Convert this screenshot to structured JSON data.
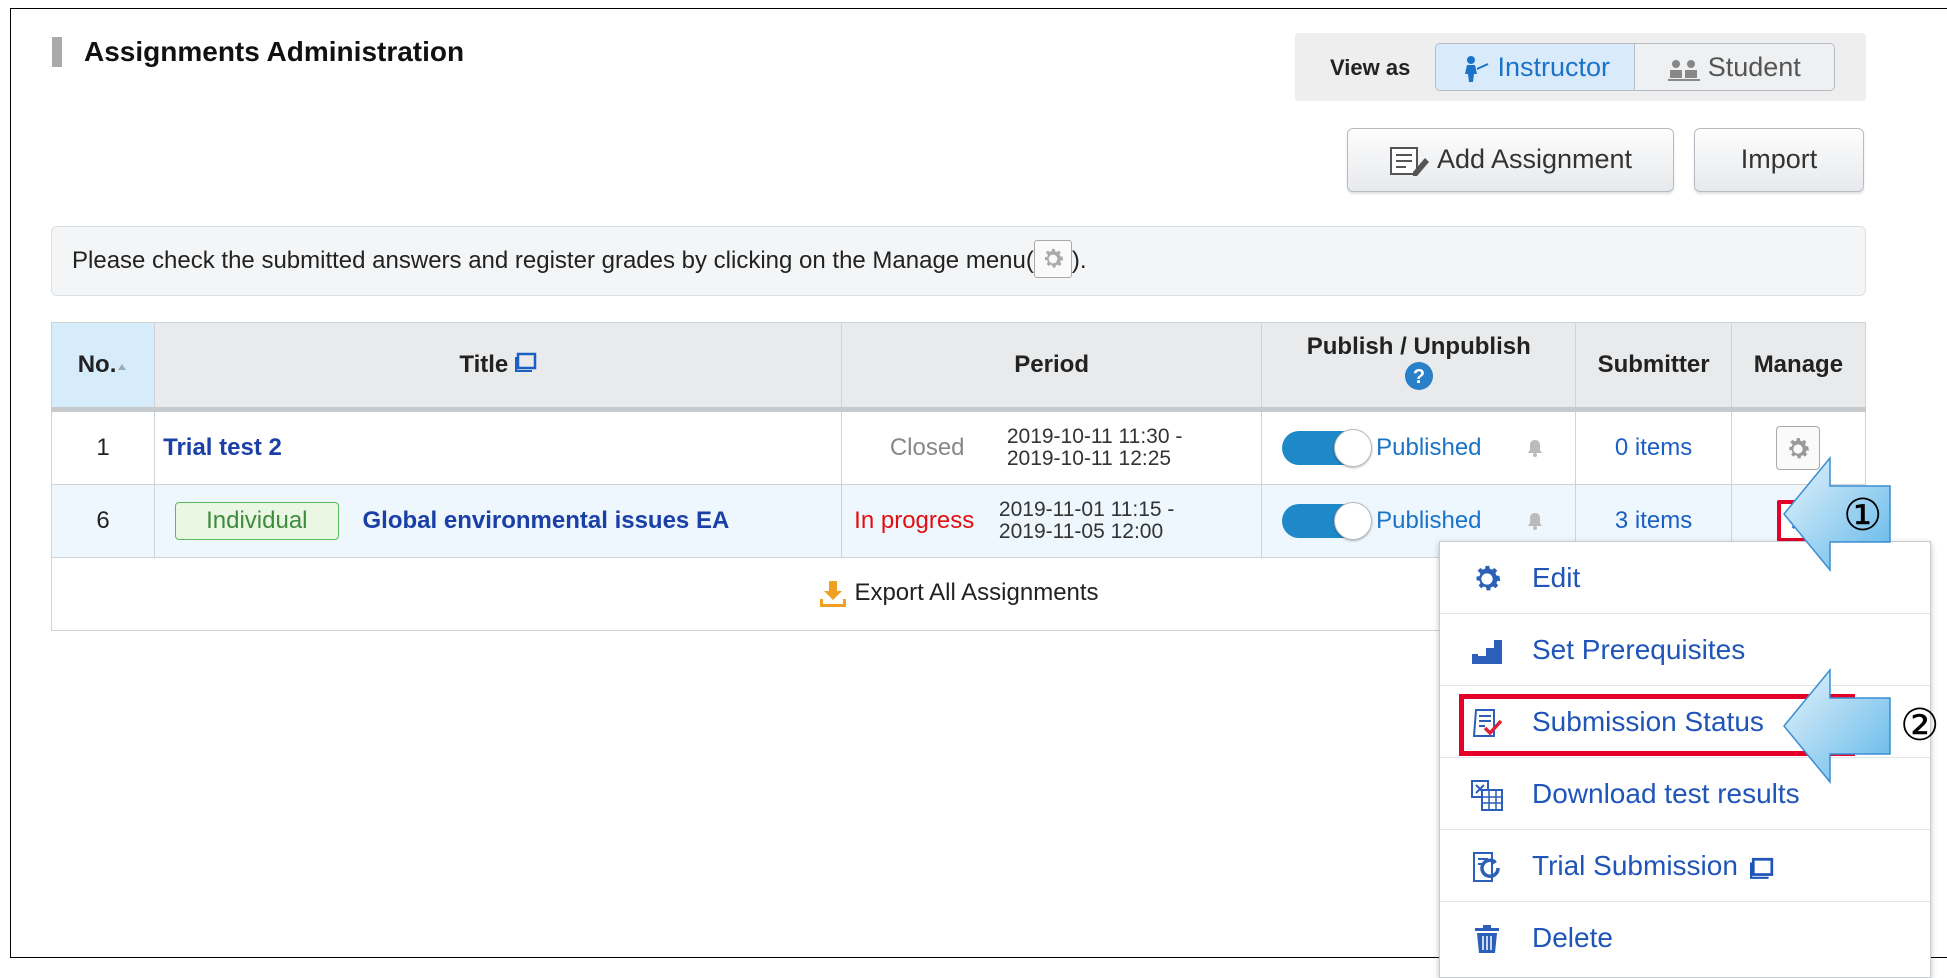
{
  "header": {
    "title": "Assignments Administration",
    "view_as_label": "View as",
    "view_instructor": "Instructor",
    "view_student": "Student"
  },
  "toolbar": {
    "add_label": "Add Assignment",
    "import_label": "Import"
  },
  "notice": {
    "text_before": "Please check the submitted answers and register grades by clicking on the Manage menu(",
    "text_after": ")."
  },
  "table": {
    "headers": {
      "no": "No.",
      "title": "Title",
      "period": "Period",
      "publish": "Publish / Unpublish",
      "submitter": "Submitter",
      "manage": "Manage"
    },
    "rows": [
      {
        "no": "1",
        "badge": "",
        "title": "Trial test 2",
        "status": "Closed",
        "period_start": "2019-10-11 11:30 -",
        "period_end": "2019-10-11 12:25",
        "publish": "Published",
        "submitter": "0 items"
      },
      {
        "no": "6",
        "badge": "Individual",
        "title": "Global environmental issues EA",
        "status": "In progress",
        "period_start": "2019-11-01 11:15 -",
        "period_end": "2019-11-05 12:00",
        "publish": "Published",
        "submitter": "3 items"
      }
    ],
    "export_label": "Export All Assignments"
  },
  "menu": {
    "items": [
      {
        "label": "Edit",
        "icon": "gear-icon"
      },
      {
        "label": "Set Prerequisites",
        "icon": "stairs-icon"
      },
      {
        "label": "Submission Status",
        "icon": "checklist-icon"
      },
      {
        "label": "Download test results",
        "icon": "spreadsheet-icon"
      },
      {
        "label": "Trial Submission",
        "icon": "trial-icon"
      },
      {
        "label": "Delete",
        "icon": "trash-icon"
      }
    ]
  },
  "annotations": {
    "step1": "①",
    "step2": "②"
  },
  "colors": {
    "accent": "#1a73c8",
    "link": "#1a3fa6",
    "highlight": "#e5002a",
    "toggle": "#1e88c9",
    "in_progress": "#e01010"
  }
}
